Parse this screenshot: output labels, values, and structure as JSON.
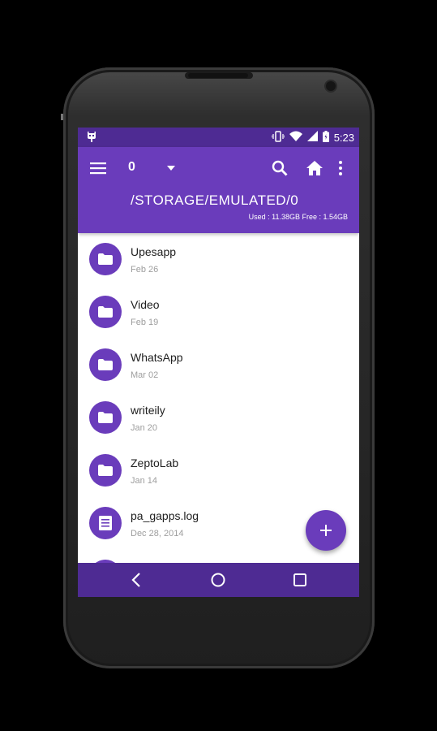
{
  "statusbar": {
    "time": "5:23"
  },
  "toolbar": {
    "counter": "0",
    "path": "/STORAGE/EMULATED/0",
    "storage": "Used : 11.38GB Free : 1.54GB"
  },
  "files": [
    {
      "name": "Upesapp",
      "date": "Feb 26",
      "icon": "folder-icon"
    },
    {
      "name": "Video",
      "date": "Feb 19",
      "icon": "folder-icon"
    },
    {
      "name": "WhatsApp",
      "date": "Mar 02",
      "icon": "folder-icon"
    },
    {
      "name": "writeily",
      "date": "Jan 20",
      "icon": "folder-icon"
    },
    {
      "name": "ZeptoLab",
      "date": "Jan 14",
      "icon": "folder-icon"
    },
    {
      "name": "pa_gapps.log",
      "date": "Dec 28, 2014",
      "icon": "document-icon"
    }
  ],
  "fab": {
    "label": "+"
  },
  "colors": {
    "primary": "#6a3cbb",
    "primary_dark": "#4e2b93"
  }
}
